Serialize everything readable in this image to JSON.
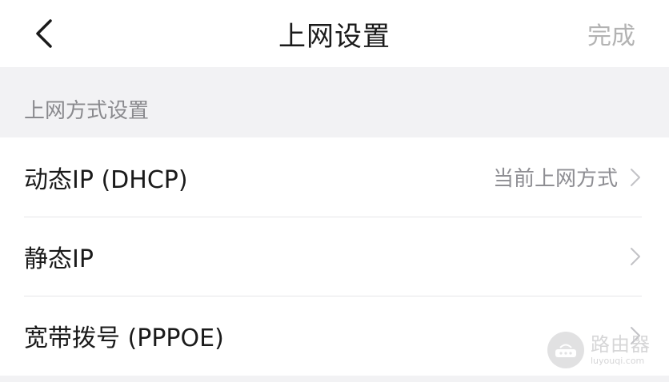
{
  "header": {
    "title": "上网设置",
    "done_label": "完成"
  },
  "section": {
    "title": "上网方式设置"
  },
  "items": [
    {
      "label": "动态IP (DHCP)",
      "sub": "当前上网方式"
    },
    {
      "label": "静态IP",
      "sub": ""
    },
    {
      "label": "宽带拨号 (PPPOE)",
      "sub": ""
    }
  ],
  "watermark": {
    "cn": "路由器",
    "en": "luyouqi.com"
  },
  "icons": {
    "back": "chevron-left-icon",
    "row": "chevron-right-icon",
    "watermark": "router-logo-icon"
  },
  "colors": {
    "header_bg": "#ffffff",
    "page_bg": "#f2f2f4",
    "done_text": "#b3b3b3",
    "section_text": "#8a8a8e",
    "divider": "#e6e6e8"
  }
}
